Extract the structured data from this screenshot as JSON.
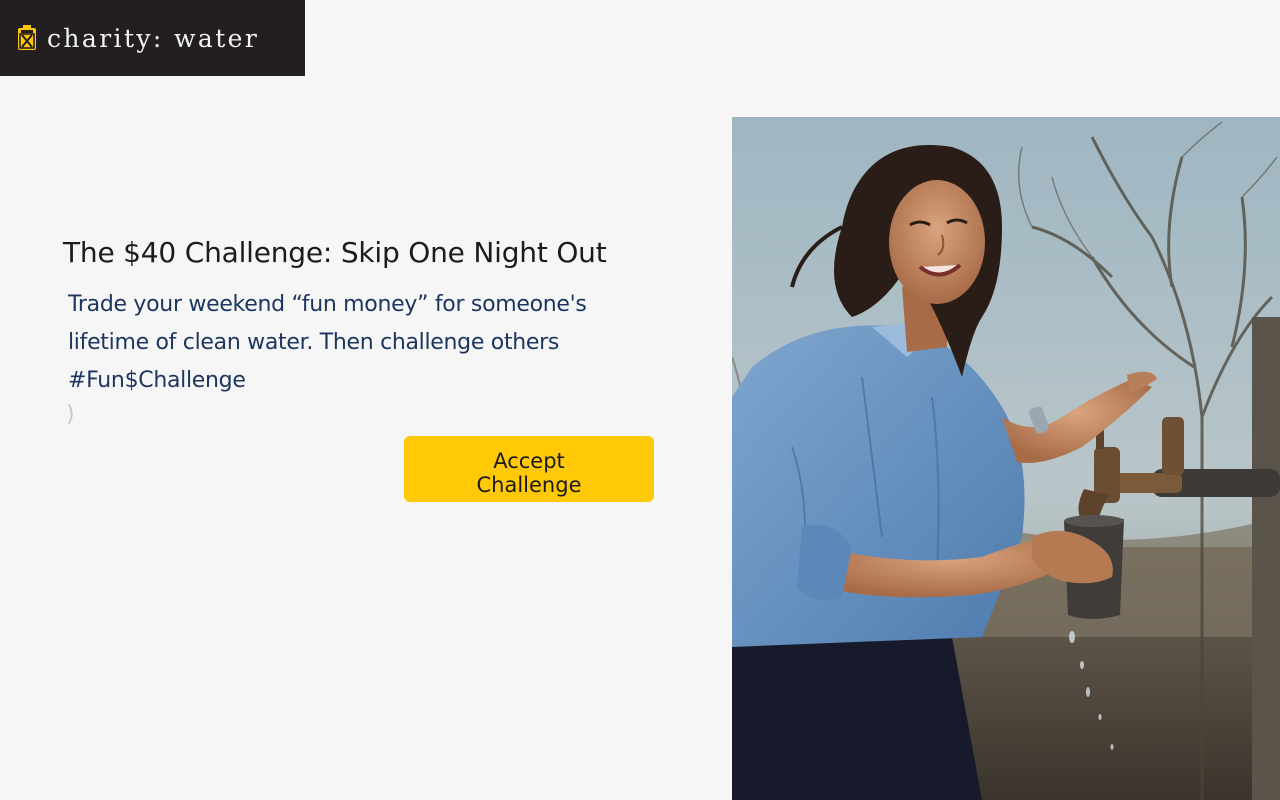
{
  "header": {
    "logo_text": "charity: water",
    "logo_icon": "jerrycan-icon",
    "brand_color": "#ffc907",
    "bar_color": "#231f20"
  },
  "hero": {
    "headline": "The $40 Challenge: Skip One Night Out",
    "body_lines": [
      "Trade your weekend “fun money” for someone's",
      "lifetime of clean water. Then challenge others",
      "#Fun$Challenge"
    ],
    "stray_glyph": ")",
    "cta": {
      "line1": "Accept",
      "line2": "Challenge",
      "color": "#ffc907"
    },
    "text_color": "#1d3660"
  },
  "photo": {
    "description_icon": "girl-at-water-tap-photo"
  }
}
